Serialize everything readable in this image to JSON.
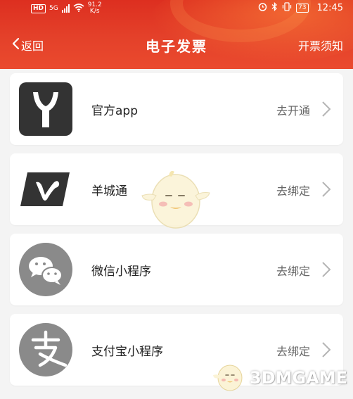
{
  "status_bar": {
    "network_badge": "HD",
    "signal_label": "5G",
    "speed_value": "91.2",
    "speed_unit": "K/s",
    "battery": "73",
    "time": "12:45"
  },
  "nav": {
    "back_label": "返回",
    "title": "电子发票",
    "notice_label": "开票须知"
  },
  "items": [
    {
      "name": "官方app",
      "action": "去开通",
      "icon": "official-app-logo"
    },
    {
      "name": "羊城通",
      "action": "去绑定",
      "icon": "yangchengtong-logo"
    },
    {
      "name": "微信小程序",
      "action": "去绑定",
      "icon": "wechat-logo"
    },
    {
      "name": "支付宝小程序",
      "action": "去绑定",
      "icon": "alipay-logo"
    }
  ],
  "watermark": {
    "text": "3DMGAME"
  },
  "colors": {
    "header_red": "#e23a26",
    "logo_dark": "#333333",
    "logo_gray": "#8a8a8a"
  }
}
